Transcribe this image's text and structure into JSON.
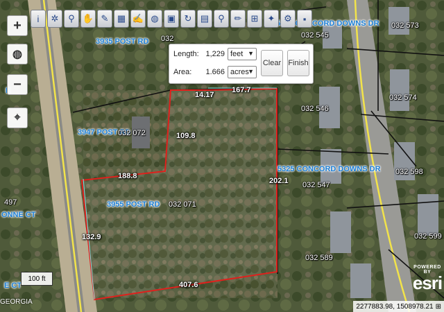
{
  "toolbar": {
    "tools": [
      {
        "name": "info-icon",
        "glyph": "i"
      },
      {
        "name": "select-icon",
        "glyph": "✲"
      },
      {
        "name": "zoom-search-icon",
        "glyph": "⚲"
      },
      {
        "name": "pan-icon",
        "glyph": "✋"
      },
      {
        "name": "eraser-icon",
        "glyph": "✎"
      },
      {
        "name": "layers-icon",
        "glyph": "▦"
      },
      {
        "name": "draw-icon",
        "glyph": "✍"
      },
      {
        "name": "globe-icon",
        "glyph": "◍"
      },
      {
        "name": "print-icon",
        "glyph": "▣"
      },
      {
        "name": "refresh-icon",
        "glyph": "↻"
      },
      {
        "name": "legend-icon",
        "glyph": "▤"
      },
      {
        "name": "search-icon",
        "glyph": "⚲"
      },
      {
        "name": "pencil-icon",
        "glyph": "✏"
      },
      {
        "name": "measure-icon",
        "glyph": "⊞"
      },
      {
        "name": "identify-icon",
        "glyph": "✦"
      },
      {
        "name": "settings-icon",
        "glyph": "⚙"
      },
      {
        "name": "save-icon",
        "glyph": "▪"
      }
    ]
  },
  "zoom": {
    "in": "+",
    "globe": "◍",
    "out": "−",
    "locate": "⌖"
  },
  "measure_panel": {
    "length_label": "Length:",
    "length_value": "1,229",
    "length_unit": "feet",
    "area_label": "Area:",
    "area_value": "1.666",
    "area_unit": "acres",
    "clear_label": "Clear",
    "finish_label": "Finish"
  },
  "roads": {
    "r1": "3935 POST RD",
    "r2": "5345 CONCORD DOWNS DR",
    "r3": "3947 POST RD",
    "r4": "5325 CONCORD DOWNS DR",
    "r5": "3955 POST RD",
    "r6": "ONNE CT",
    "r7": "E CT",
    "r8": "E",
    "r9": "E CT"
  },
  "parcels": {
    "p032_072": "032  072",
    "p032_071": "032  071",
    "p032_545": "032  545",
    "p032_546": "032  546",
    "p032_547": "032  547",
    "p032_589": "032  589",
    "p032_573": "032  573",
    "p032_574": "032  574",
    "p032_598": "032  598",
    "p032_599": "032  599",
    "p032_top": "032",
    "p497": "497"
  },
  "segments": {
    "s1": "14.17",
    "s2": "167.7",
    "s3": "109.8",
    "s4": "188.8",
    "s5": "202.1",
    "s6": "132.9",
    "s7": "407.6"
  },
  "scale_label": "100 ft",
  "attribution": "GEORGIA",
  "coordinates": "2277883.98, 1508978.21",
  "esri": {
    "powered_by": "POWERED BY",
    "word": "esri"
  },
  "colors": {
    "measure_line": "#e0201c",
    "parcel_line": "#111111",
    "road_label": "#1c7fd6"
  }
}
